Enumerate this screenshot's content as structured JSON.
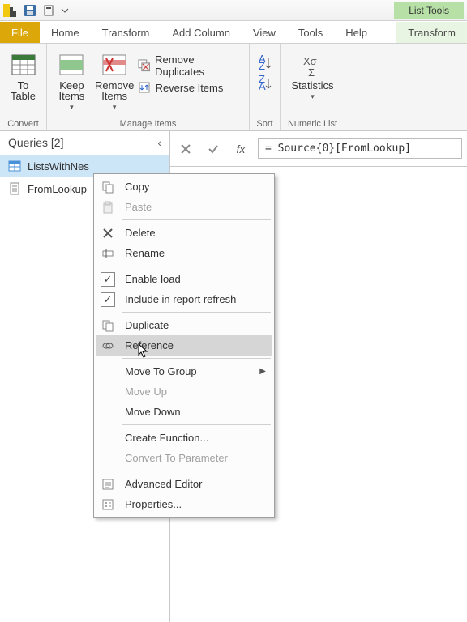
{
  "title_tab": {
    "list_tools": "List Tools"
  },
  "ribbon_tabs": {
    "file": "File",
    "home": "Home",
    "transform": "Transform",
    "add_column": "Add Column",
    "view": "View",
    "tools": "Tools",
    "help": "Help",
    "ctx_transform": "Transform"
  },
  "ribbon": {
    "convert": {
      "to_table": "To\nTable",
      "group": "Convert"
    },
    "manage": {
      "keep": "Keep\nItems",
      "remove": "Remove\nItems",
      "remove_dup": "Remove Duplicates",
      "reverse": "Reverse Items",
      "group": "Manage Items"
    },
    "sort": {
      "group": "Sort"
    },
    "numeric": {
      "stats": "Statistics",
      "group": "Numeric List"
    }
  },
  "queries": {
    "title": "Queries [2]",
    "items": [
      "ListsWithNes",
      "FromLookup"
    ]
  },
  "formula": "= Source{0}[FromLookup]",
  "context_menu": {
    "copy": "Copy",
    "paste": "Paste",
    "delete": "Delete",
    "rename": "Rename",
    "enable_load": "Enable load",
    "include_refresh": "Include in report refresh",
    "duplicate": "Duplicate",
    "reference": "Reference",
    "move_group": "Move To Group",
    "move_up": "Move Up",
    "move_down": "Move Down",
    "create_fn": "Create Function...",
    "convert_param": "Convert To Parameter",
    "adv_editor": "Advanced Editor",
    "properties": "Properties..."
  }
}
